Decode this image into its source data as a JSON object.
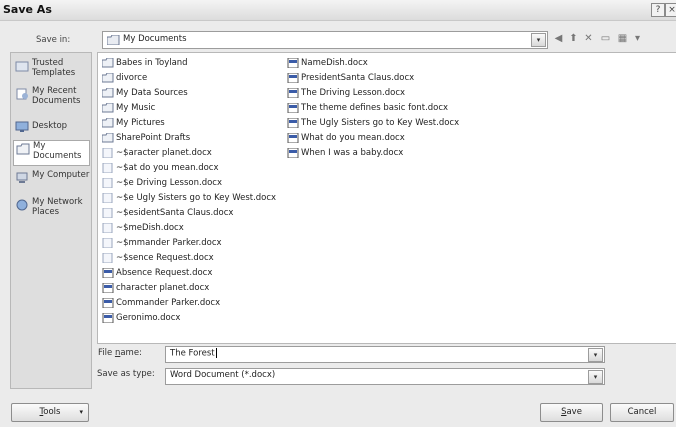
{
  "window": {
    "title": "Save As"
  },
  "save_in": {
    "label": "Save in:",
    "value": "My Documents"
  },
  "places": [
    {
      "label": "Trusted Templates",
      "icon": "trusted-templates-icon"
    },
    {
      "label": "My Recent Documents",
      "icon": "recent-documents-icon"
    },
    {
      "label": "Desktop",
      "icon": "desktop-icon"
    },
    {
      "label": "My Documents",
      "icon": "my-documents-icon"
    },
    {
      "label": "My Computer",
      "icon": "my-computer-icon"
    },
    {
      "label": "My Network Places",
      "icon": "network-places-icon"
    }
  ],
  "files_col1": [
    {
      "name": "Babes in Toyland",
      "type": "folder"
    },
    {
      "name": "divorce",
      "type": "folder"
    },
    {
      "name": "My Data Sources",
      "type": "folder"
    },
    {
      "name": "My Music",
      "type": "folder"
    },
    {
      "name": "My Pictures",
      "type": "folder"
    },
    {
      "name": "SharePoint Drafts",
      "type": "folder"
    },
    {
      "name": "~$aracter planet.docx",
      "type": "temp"
    },
    {
      "name": "~$at do you mean.docx",
      "type": "temp"
    },
    {
      "name": "~$e Driving Lesson.docx",
      "type": "temp"
    },
    {
      "name": "~$e Ugly Sisters go to Key West.docx",
      "type": "temp"
    },
    {
      "name": "~$esidentSanta Claus.docx",
      "type": "temp"
    },
    {
      "name": "~$meDish.docx",
      "type": "temp"
    },
    {
      "name": "~$mmander Parker.docx",
      "type": "temp"
    },
    {
      "name": "~$sence Request.docx",
      "type": "temp"
    },
    {
      "name": "Absence Request.docx",
      "type": "doc"
    },
    {
      "name": "character planet.docx",
      "type": "doc"
    },
    {
      "name": "Commander Parker.docx",
      "type": "doc"
    },
    {
      "name": "Geronimo.docx",
      "type": "doc"
    }
  ],
  "files_col2": [
    {
      "name": "NameDish.docx",
      "type": "doc"
    },
    {
      "name": "PresidentSanta Claus.docx",
      "type": "doc"
    },
    {
      "name": "The Driving Lesson.docx",
      "type": "doc"
    },
    {
      "name": "The theme defines basic font.docx",
      "type": "doc"
    },
    {
      "name": "The Ugly Sisters go to Key West.docx",
      "type": "doc"
    },
    {
      "name": "What do you mean.docx",
      "type": "doc"
    },
    {
      "name": "When I was a baby.docx",
      "type": "doc"
    }
  ],
  "file_name": {
    "label_pre": "File ",
    "label_u": "n",
    "label_post": "ame:",
    "value": "The Forest"
  },
  "save_as_type": {
    "label": "Save as type:",
    "value": "Word Document (*.docx)"
  },
  "buttons": {
    "tools_u": "T",
    "tools_rest": "ools",
    "save_u": "S",
    "save_rest": "ave",
    "cancel": "Cancel"
  },
  "colors": {
    "folder": "#e7c45a",
    "doc": "#3b5ca8",
    "temp": "#9aa6bd"
  }
}
